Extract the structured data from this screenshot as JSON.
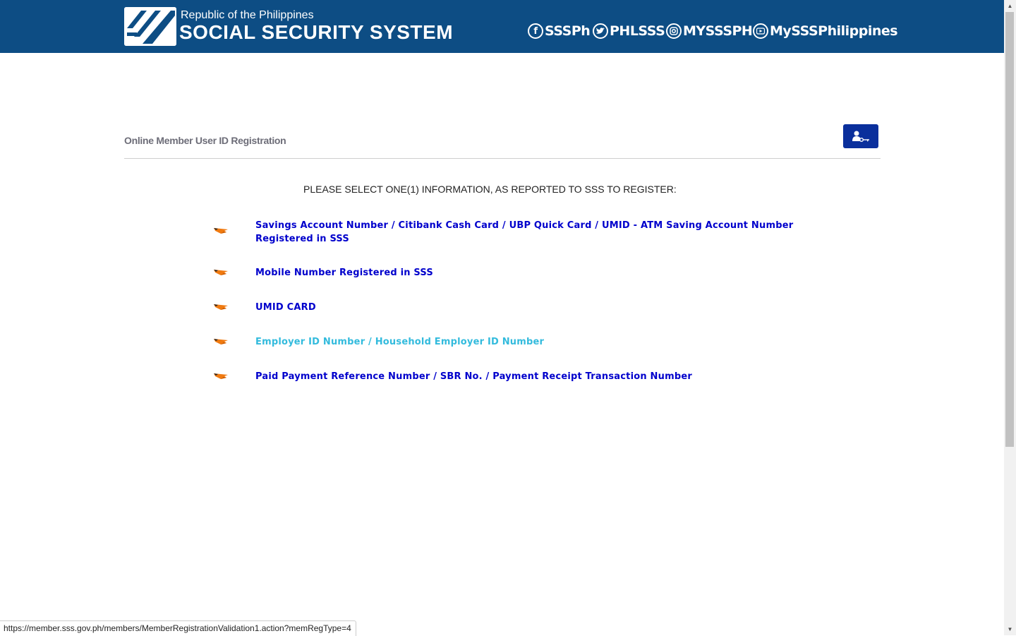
{
  "header": {
    "logo_small": "Republic of the Philippines",
    "logo_big": "SOCIAL SECURITY SYSTEM",
    "social": [
      {
        "icon": "facebook-icon",
        "label": "SSSPh"
      },
      {
        "icon": "twitter-icon",
        "label": "PHLSSS"
      },
      {
        "icon": "instagram-icon",
        "label": "MYSSSPH"
      },
      {
        "icon": "youtube-icon",
        "label": "MySSSPhilippines"
      }
    ]
  },
  "main": {
    "title": "Online Member User ID Registration",
    "home_icon": "user-key-icon",
    "instruction": "PLEASE SELECT ONE(1) INFORMATION, AS REPORTED TO SSS TO REGISTER:",
    "options": [
      {
        "line1": "Savings Account Number / Citibank Cash Card / UBP Quick Card / UMID - ATM Saving Account Number",
        "line2": "Registered in SSS"
      },
      {
        "line1": "Mobile Number Registered in SSS"
      },
      {
        "line1": "UMID CARD"
      },
      {
        "line1": "Employer ID Number / Household Employer ID Number"
      },
      {
        "line1": "Paid Payment Reference Number / SBR No. / Payment Receipt Transaction Number"
      }
    ]
  },
  "status_bar": {
    "url": "https://member.sss.gov.ph/members/MemberRegistrationValidation1.action?memRegType=4"
  },
  "colors": {
    "header_bg": "#0d4d84",
    "link": "#0000cc",
    "link_hover": "#33bbdd",
    "button_bg": "#0a2f9c"
  }
}
